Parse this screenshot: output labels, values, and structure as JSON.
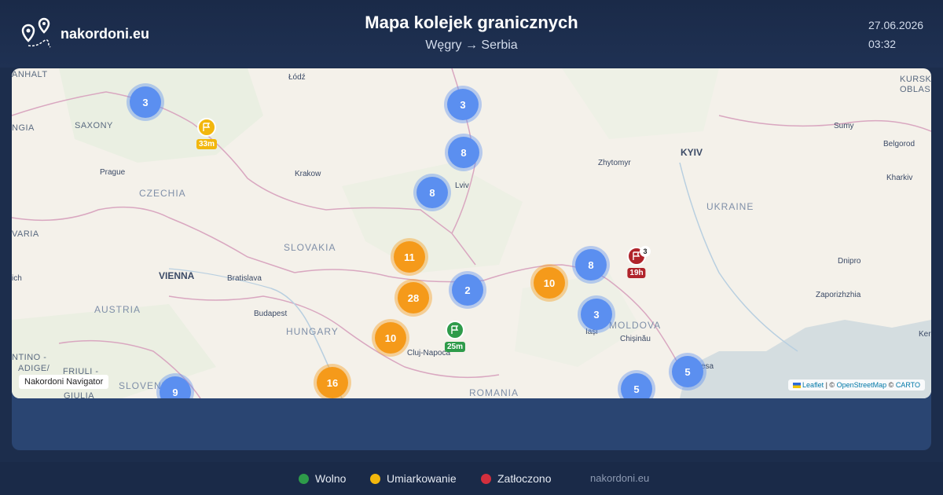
{
  "header": {
    "brand": "nakordoni.eu",
    "title": "Mapa kolejek granicznych",
    "route": "Węgry → Serbia",
    "date": "27.06.2026",
    "time": "03:32"
  },
  "map": {
    "labels": [
      {
        "text": "ANHALT",
        "cls": "region"
      },
      {
        "text": "SAXONY",
        "cls": "region"
      },
      {
        "text": "NGIA",
        "cls": "region"
      },
      {
        "text": "Łódź",
        "cls": "pop"
      },
      {
        "text": "Prague",
        "cls": "pop"
      },
      {
        "text": "CZECHIA",
        "cls": "country"
      },
      {
        "text": "Krakow",
        "cls": "pop"
      },
      {
        "text": "Lviv",
        "cls": "pop"
      },
      {
        "text": "Zhytomyr",
        "cls": "pop"
      },
      {
        "text": "KYIV",
        "cls": "bigcity"
      },
      {
        "text": "Sumy",
        "cls": "pop"
      },
      {
        "text": "Belgorod",
        "cls": "pop"
      },
      {
        "text": "Kharkiv",
        "cls": "pop"
      },
      {
        "text": "KURSK",
        "cls": "region"
      },
      {
        "text": "OBLAS",
        "cls": "region"
      },
      {
        "text": "UKRAINE",
        "cls": "country"
      },
      {
        "text": "VARIA",
        "cls": "region"
      },
      {
        "text": "SLOVAKIA",
        "cls": "country"
      },
      {
        "text": "ich",
        "cls": "pop"
      },
      {
        "text": "VIENNA",
        "cls": "bigcity"
      },
      {
        "text": "Bratislava",
        "cls": "pop"
      },
      {
        "text": "Dnipro",
        "cls": "pop"
      },
      {
        "text": "AUSTRIA",
        "cls": "country"
      },
      {
        "text": "Zaporizhzhia",
        "cls": "pop"
      },
      {
        "text": "Budapest",
        "cls": "pop"
      },
      {
        "text": "HUNGARY",
        "cls": "country"
      },
      {
        "text": "MOLDOVA",
        "cls": "country"
      },
      {
        "text": "Iași",
        "cls": "pop"
      },
      {
        "text": "Chișinău",
        "cls": "pop"
      },
      {
        "text": "Cluj-Napoca",
        "cls": "pop"
      },
      {
        "text": "NTINO -",
        "cls": "region"
      },
      {
        "text": "ADIGE/",
        "cls": "region"
      },
      {
        "text": "FRIULI -",
        "cls": "region"
      },
      {
        "text": "GIULIA",
        "cls": "region"
      },
      {
        "text": "SLOVENI",
        "cls": "country"
      },
      {
        "text": "ROMANIA",
        "cls": "country"
      },
      {
        "text": "esa",
        "cls": "pop"
      },
      {
        "text": "Kerch",
        "cls": "pop"
      }
    ],
    "clusters": [
      {
        "value": "3",
        "color": "blue"
      },
      {
        "value": "3",
        "color": "blue"
      },
      {
        "value": "8",
        "color": "blue"
      },
      {
        "value": "8",
        "color": "blue"
      },
      {
        "value": "11",
        "color": "orange"
      },
      {
        "value": "8",
        "color": "blue"
      },
      {
        "value": "2",
        "color": "blue"
      },
      {
        "value": "28",
        "color": "orange"
      },
      {
        "value": "10",
        "color": "orange"
      },
      {
        "value": "3",
        "color": "blue"
      },
      {
        "value": "10",
        "color": "orange"
      },
      {
        "value": "16",
        "color": "orange"
      },
      {
        "value": "9",
        "color": "blue"
      },
      {
        "value": "5",
        "color": "blue"
      },
      {
        "value": "5",
        "color": "blue"
      }
    ],
    "flags": [
      {
        "color": "yellow",
        "wait": "33m",
        "count": ""
      },
      {
        "color": "green",
        "wait": "25m",
        "count": ""
      },
      {
        "color": "red",
        "wait": "19h",
        "count": "3"
      }
    ],
    "nav_label": "Nakordoni Navigator",
    "attribution": {
      "leaflet": "Leaflet",
      "sep": "| ©",
      "osm": "OpenStreetMap",
      "copy": "©",
      "carto": "CARTO"
    }
  },
  "legend": [
    {
      "label": "Wolno",
      "color": "#2e9b4a"
    },
    {
      "label": "Umiarkowanie",
      "color": "#f2b70d"
    },
    {
      "label": "Zatłoczono",
      "color": "#d32f3d"
    }
  ],
  "footer_site": "nakordoni.eu"
}
